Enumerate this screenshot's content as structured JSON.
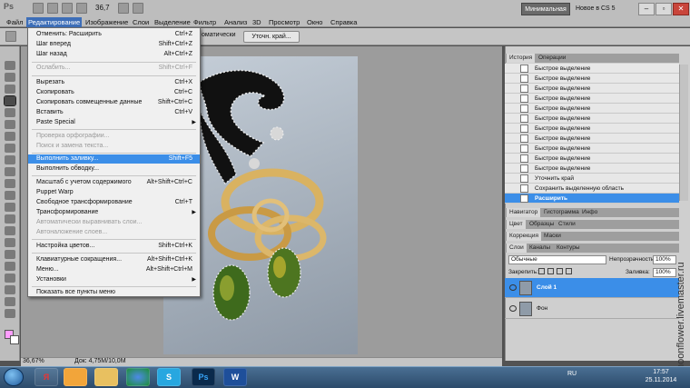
{
  "app": {
    "logo": "Ps",
    "zoom": "36,7",
    "workspace_label": "Минимальная",
    "new_in": "Новое в CS 5"
  },
  "menu": [
    "Файл",
    "Редактирование",
    "Изображение",
    "Слои",
    "Выделение",
    "Фильтр",
    "Анализ",
    "3D",
    "Просмотр",
    "Окно",
    "Справка"
  ],
  "options": {
    "auto_enhance": "оматически",
    "refine_edge": "Уточн. край..."
  },
  "edit_menu": [
    {
      "label": "Отменить: Расширить",
      "shortcut": "Ctrl+Z"
    },
    {
      "label": "Шаг вперед",
      "shortcut": "Shift+Ctrl+Z"
    },
    {
      "label": "Шаг назад",
      "shortcut": "Alt+Ctrl+Z"
    },
    {
      "label": "Ослабить...",
      "shortcut": "Shift+Ctrl+F"
    },
    {
      "label": "Вырезать",
      "shortcut": "Ctrl+X"
    },
    {
      "label": "Скопировать",
      "shortcut": "Ctrl+C"
    },
    {
      "label": "Скопировать совмещенные данные",
      "shortcut": "Shift+Ctrl+C"
    },
    {
      "label": "Вставить",
      "shortcut": "Ctrl+V"
    },
    {
      "label": "Paste Special",
      "shortcut": ""
    },
    {
      "label": "Проверка орфографии...",
      "shortcut": ""
    },
    {
      "label": "Поиск и замена текста...",
      "shortcut": ""
    },
    {
      "label": "Выполнить заливку...",
      "shortcut": "Shift+F5"
    },
    {
      "label": "Выполнить обводку...",
      "shortcut": ""
    },
    {
      "label": "Масштаб с учетом содержимого",
      "shortcut": "Alt+Shift+Ctrl+C"
    },
    {
      "label": "Puppet Warp",
      "shortcut": ""
    },
    {
      "label": "Свободное трансформирование",
      "shortcut": "Ctrl+T"
    },
    {
      "label": "Трансформирование",
      "shortcut": ""
    },
    {
      "label": "Автоматически выравнивать слои...",
      "shortcut": ""
    },
    {
      "label": "Автоналожение слоев...",
      "shortcut": ""
    },
    {
      "label": "Настройка цветов...",
      "shortcut": "Shift+Ctrl+K"
    },
    {
      "label": "Клавиатурные сокращения...",
      "shortcut": "Alt+Shift+Ctrl+K"
    },
    {
      "label": "Меню...",
      "shortcut": "Alt+Shift+Ctrl+M"
    },
    {
      "label": "Установки",
      "shortcut": ""
    },
    {
      "label": "Показать все пункты меню",
      "shortcut": ""
    }
  ],
  "history_panel": {
    "tabs": [
      "История",
      "Операции"
    ],
    "items": [
      "Быстрое выделение",
      "Быстрое выделение",
      "Быстрое выделение",
      "Быстрое выделение",
      "Быстрое выделение",
      "Быстрое выделение",
      "Быстрое выделение",
      "Быстрое выделение",
      "Быстрое выделение",
      "Быстрое выделение",
      "Быстрое выделение",
      "Уточнить край",
      "Сохранить выделенную область",
      "Расширить"
    ]
  },
  "navigator_tabs": [
    "Навигатор",
    "Гистограмма",
    "Инфо"
  ],
  "color_tabs": [
    "Цвет",
    "Образцы",
    "Стили"
  ],
  "correction_tabs": [
    "Коррекция",
    "Маски"
  ],
  "layers_panel": {
    "tabs": [
      "Слои",
      "Каналы",
      "Контуры"
    ],
    "blend_mode": "Обычные",
    "opacity_label": "Непрозрачность:",
    "opacity": "100%",
    "lock_label": "Закрепить:",
    "fill_label": "Заливка:",
    "fill": "100%",
    "layers": [
      "Слой 1",
      "Фон"
    ]
  },
  "status": {
    "zoom": "36,67%",
    "doc": "Док: 4,75M/10,0M"
  },
  "watermark": "moonflower.livemaster.ru",
  "taskbar": {
    "lang": "RU",
    "time": "17:57",
    "date": "25.11.2014"
  },
  "colors": {
    "foreground": "#ff9eff",
    "background": "#ffffff",
    "highlight": "#3b8ee8"
  }
}
